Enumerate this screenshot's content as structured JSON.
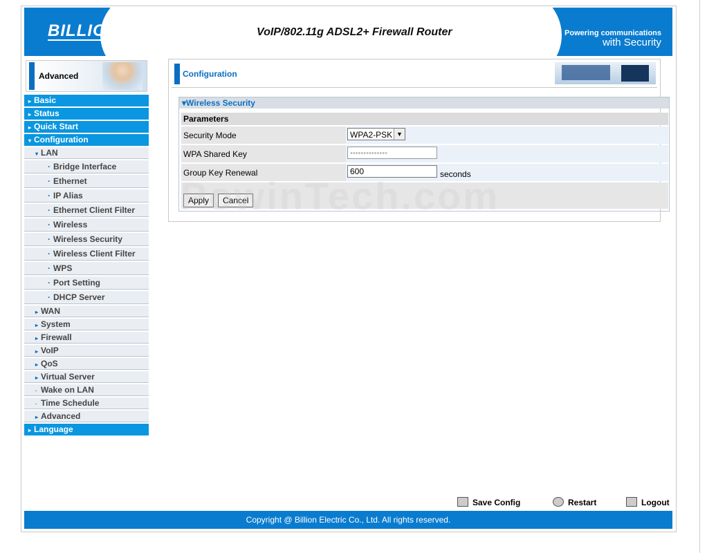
{
  "header": {
    "brand": "BILLION",
    "product_title": "VoIP/802.11g ADSL2+ Firewall Router",
    "tagline_top": "Powering communications",
    "tagline_bottom": "with Security"
  },
  "sidebar": {
    "section_label": "Advanced",
    "top_items": [
      {
        "label": "Basic"
      },
      {
        "label": "Status"
      },
      {
        "label": "Quick Start"
      },
      {
        "label": "Configuration"
      }
    ],
    "lan_label": "LAN",
    "lan_items": [
      {
        "label": "Bridge Interface"
      },
      {
        "label": "Ethernet"
      },
      {
        "label": "IP Alias"
      },
      {
        "label": "Ethernet Client Filter"
      },
      {
        "label": "Wireless"
      },
      {
        "label": "Wireless Security"
      },
      {
        "label": "Wireless Client Filter"
      },
      {
        "label": "WPS"
      },
      {
        "label": "Port Setting"
      },
      {
        "label": "DHCP Server"
      }
    ],
    "config_items": [
      {
        "label": "WAN"
      },
      {
        "label": "System"
      },
      {
        "label": "Firewall"
      },
      {
        "label": "VoIP"
      },
      {
        "label": "QoS"
      },
      {
        "label": "Virtual Server"
      },
      {
        "label": "Wake on LAN"
      },
      {
        "label": "Time Schedule"
      },
      {
        "label": "Advanced"
      }
    ],
    "language_label": "Language"
  },
  "main": {
    "title": "Configuration",
    "section_title": "Wireless Security",
    "params_header": "Parameters",
    "security_mode_label": "Security Mode",
    "security_mode_value": "WPA2-PSK",
    "wpa_key_label": "WPA Shared Key",
    "wpa_key_value": "••••••••••••••",
    "group_key_label": "Group Key Renewal",
    "group_key_value": "600",
    "group_key_unit": "seconds",
    "apply_label": "Apply",
    "cancel_label": "Cancel"
  },
  "watermark": "PowinTech.com",
  "footer": {
    "save_config": "Save Config",
    "restart": "Restart",
    "logout": "Logout",
    "copyright": "Copyright @ Billion Electric Co., Ltd. All rights reserved."
  }
}
